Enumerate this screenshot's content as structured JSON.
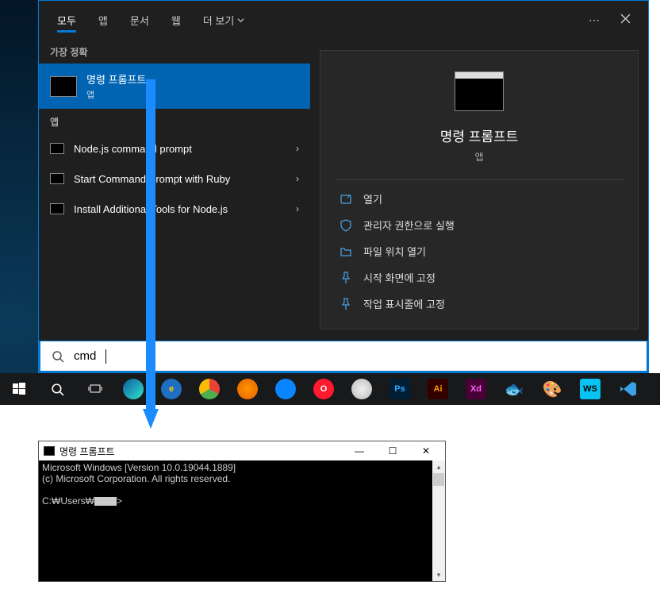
{
  "tabs": {
    "all": "모두",
    "apps": "앱",
    "docs": "문서",
    "web": "웹",
    "more": "더 보기"
  },
  "sections": {
    "best_match": "가장 정확",
    "apps": "앱"
  },
  "best_result": {
    "title": "명령 프롬프트",
    "subtitle": "앱"
  },
  "app_results": [
    {
      "label": "Node.js command prompt"
    },
    {
      "label": "Start Command Prompt with Ruby"
    },
    {
      "label": "Install Additional Tools for Node.js"
    }
  ],
  "preview": {
    "title": "명령 프롬프트",
    "subtitle": "앱",
    "actions": [
      {
        "icon": "open",
        "label": "열기"
      },
      {
        "icon": "admin",
        "label": "관리자 권한으로 실행"
      },
      {
        "icon": "location",
        "label": "파일 위치 열기"
      },
      {
        "icon": "pin-start",
        "label": "시작 화면에 고정"
      },
      {
        "icon": "pin-taskbar",
        "label": "작업 표시줄에 고정"
      }
    ]
  },
  "search": {
    "value": "cmd"
  },
  "taskbar": {
    "apps": [
      {
        "name": "edge",
        "bg": "linear-gradient(135deg,#0c59a4,#30e6c9)"
      },
      {
        "name": "ie",
        "bg": "#1e6fc1",
        "letter": "e",
        "color": "#ffd200"
      },
      {
        "name": "chrome",
        "bg": "conic-gradient(#ea4335 0 120deg,#4caf50 120deg 240deg,#fbbc05 240deg 360deg)"
      },
      {
        "name": "firefox",
        "bg": "radial-gradient(circle,#ff9500,#e66000)"
      },
      {
        "name": "thunderbird",
        "bg": "#0a84ff"
      },
      {
        "name": "opera",
        "bg": "#ff1b2d",
        "letter": "O",
        "color": "#fff"
      },
      {
        "name": "safari",
        "bg": "radial-gradient(circle,#eee,#bbb)"
      },
      {
        "name": "photoshop",
        "bg": "#001e36",
        "letter": "Ps",
        "color": "#31a8ff",
        "square": true
      },
      {
        "name": "illustrator",
        "bg": "#330000",
        "letter": "Ai",
        "color": "#ff9a00",
        "square": true
      },
      {
        "name": "xd",
        "bg": "#470137",
        "letter": "Xd",
        "color": "#ff61f6",
        "square": true
      },
      {
        "name": "fish",
        "bg": "transparent",
        "emoji": "🐟"
      },
      {
        "name": "figma",
        "bg": "transparent",
        "emoji": "🎨"
      },
      {
        "name": "webstorm",
        "bg": "#07c3f2",
        "letter": "WS",
        "color": "#000",
        "square": true
      },
      {
        "name": "vscode",
        "bg": "transparent",
        "vscode": true
      }
    ]
  },
  "cmd": {
    "title": "명령 프롬프트",
    "line1": "Microsoft Windows [Version 10.0.19044.1889]",
    "line2": "(c) Microsoft Corporation. All rights reserved.",
    "prompt_prefix": "C:₩Users₩",
    "prompt_suffix": ">"
  }
}
